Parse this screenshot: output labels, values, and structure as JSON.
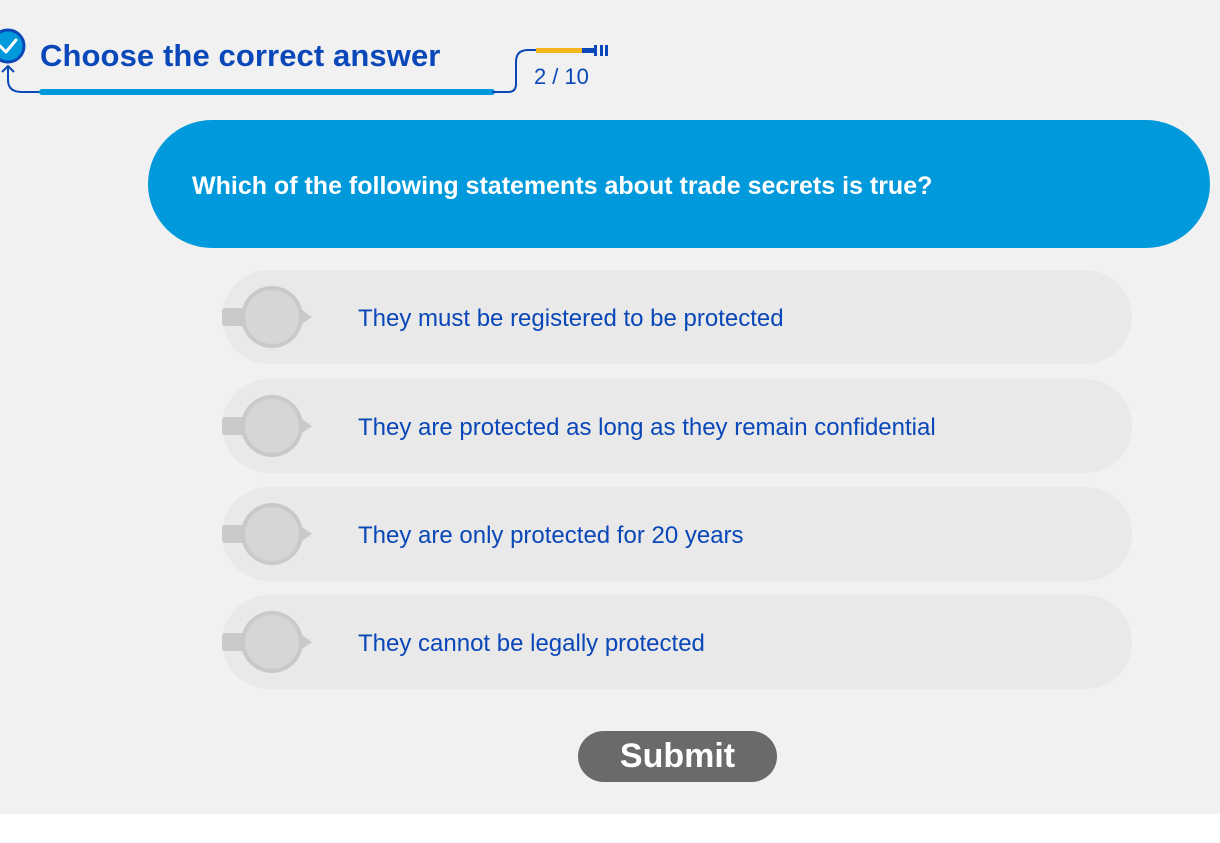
{
  "colors": {
    "accent_blue": "#0099db",
    "text_blue": "#0a47b8",
    "progress_yellow": "#f3b71c",
    "option_bg": "#e9e9e9",
    "marker_gray": "#c9c9c9",
    "submit_bg": "#6a6a6a"
  },
  "header": {
    "title": "Choose the correct answer",
    "title_icon": "check-circle-icon",
    "progress": {
      "current": "2",
      "separator": "/",
      "total": "10"
    }
  },
  "question": {
    "text": "Which of the following statements about trade secrets is true?"
  },
  "options": [
    {
      "label": "They must be registered to be protected",
      "selected": false
    },
    {
      "label": "They are protected as long as they remain confidential",
      "selected": false
    },
    {
      "label": "They are only protected for 20 years",
      "selected": false
    },
    {
      "label": "They cannot be legally protected",
      "selected": false
    }
  ],
  "submit": {
    "label": "Submit"
  }
}
